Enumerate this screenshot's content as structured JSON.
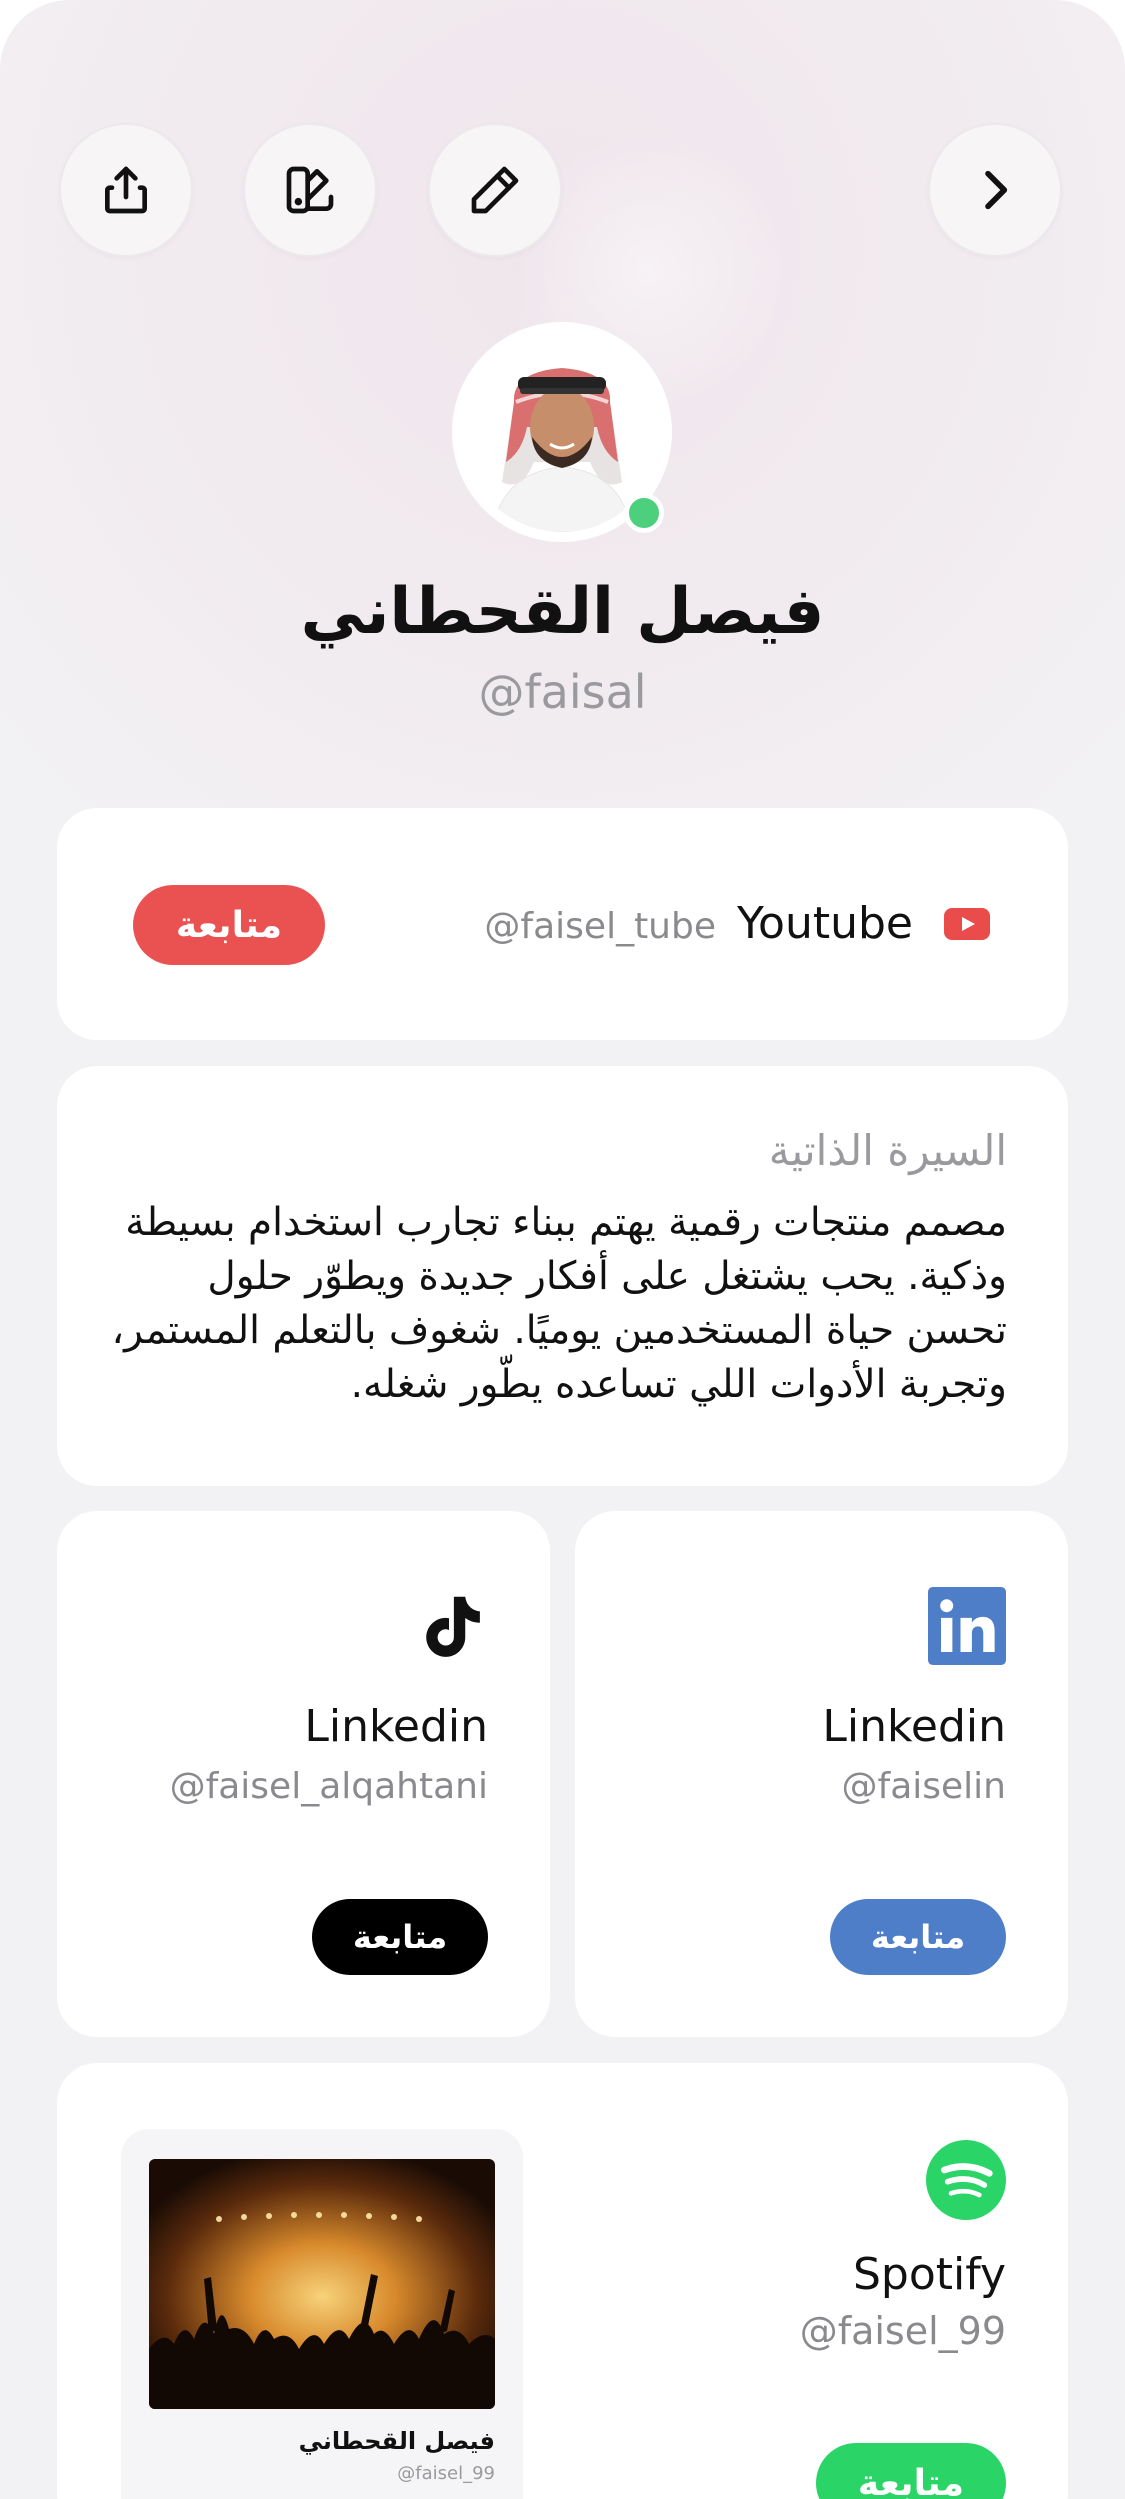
{
  "profile": {
    "name": "فيصل القحطاني",
    "handle": "@faisal",
    "online": true
  },
  "toolbar": {
    "share_icon": "share-icon",
    "theme_icon": "theme-icon",
    "edit_icon": "pencil-icon",
    "next_icon": "chevron-right-icon"
  },
  "youtube": {
    "title": "Youtube",
    "handle": "@faisel_tube",
    "follow_label": "متابعة",
    "color": "#ea5252"
  },
  "bio": {
    "title": "السيرة الذاتية",
    "text": "مصمم منتجات رقمية يهتم ببناء تجارب استخدام بسيطة وذكية. يحب يشتغل على أفكار جديدة ويطوّر حلول تحسن حياة المستخدمين يوميًا. شغوف بالتعلم المستمر، وتجربة الأدوات اللي تساعده يطّور شغله."
  },
  "tiktok": {
    "title": "Linkedin",
    "handle": "@faisel_alqahtani",
    "follow_label": "متابعة",
    "icon": "tiktok-icon",
    "color": "#000000"
  },
  "linkedin": {
    "title": "Linkedin",
    "handle": "@faiselin",
    "follow_label": "متابعة",
    "icon": "linkedin-icon",
    "color": "#4f7ec9"
  },
  "spotify": {
    "title": "Spotify",
    "handle": "@faisel_99",
    "follow_label": "متابعة",
    "icon": "spotify-icon",
    "color": "#2bd467",
    "mini": {
      "name": "فيصل القحطاني",
      "handle": "@faisel_99"
    }
  }
}
